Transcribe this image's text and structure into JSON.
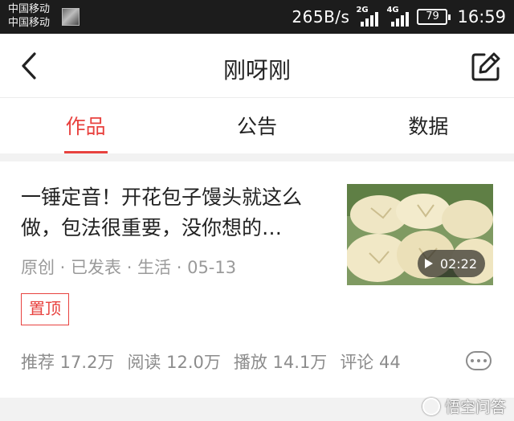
{
  "status_bar": {
    "carrier_1": "中国移动",
    "carrier_2": "中国移动",
    "net_speed": "265B/s",
    "signal_1_gen": "2G",
    "signal_2_gen": "4G",
    "battery": "79",
    "time": "16:59"
  },
  "header": {
    "title": "刚呀刚",
    "back_icon": "chevron-left-icon",
    "edit_icon": "edit-icon"
  },
  "tabs": [
    {
      "label": "作品",
      "active": true
    },
    {
      "label": "公告",
      "active": false
    },
    {
      "label": "数据",
      "active": false
    }
  ],
  "article": {
    "title": "一锤定音！开花包子馒头就这么做，包法很重要，没你想的…",
    "meta": "原创 · 已发表 · 生活 · 05-13",
    "pin_label": "置顶",
    "duration": "02:22",
    "stats": [
      {
        "label": "推荐 17.2万"
      },
      {
        "label": "阅读 12.0万"
      },
      {
        "label": "播放 14.1万"
      },
      {
        "label": "评论 44"
      }
    ],
    "more_icon": "more-dots-icon"
  },
  "watermark": {
    "text": "悟空问答"
  },
  "colors": {
    "accent": "#e8423f",
    "status_bar": "#1c1c1c",
    "muted_text": "#9a9a9a"
  }
}
